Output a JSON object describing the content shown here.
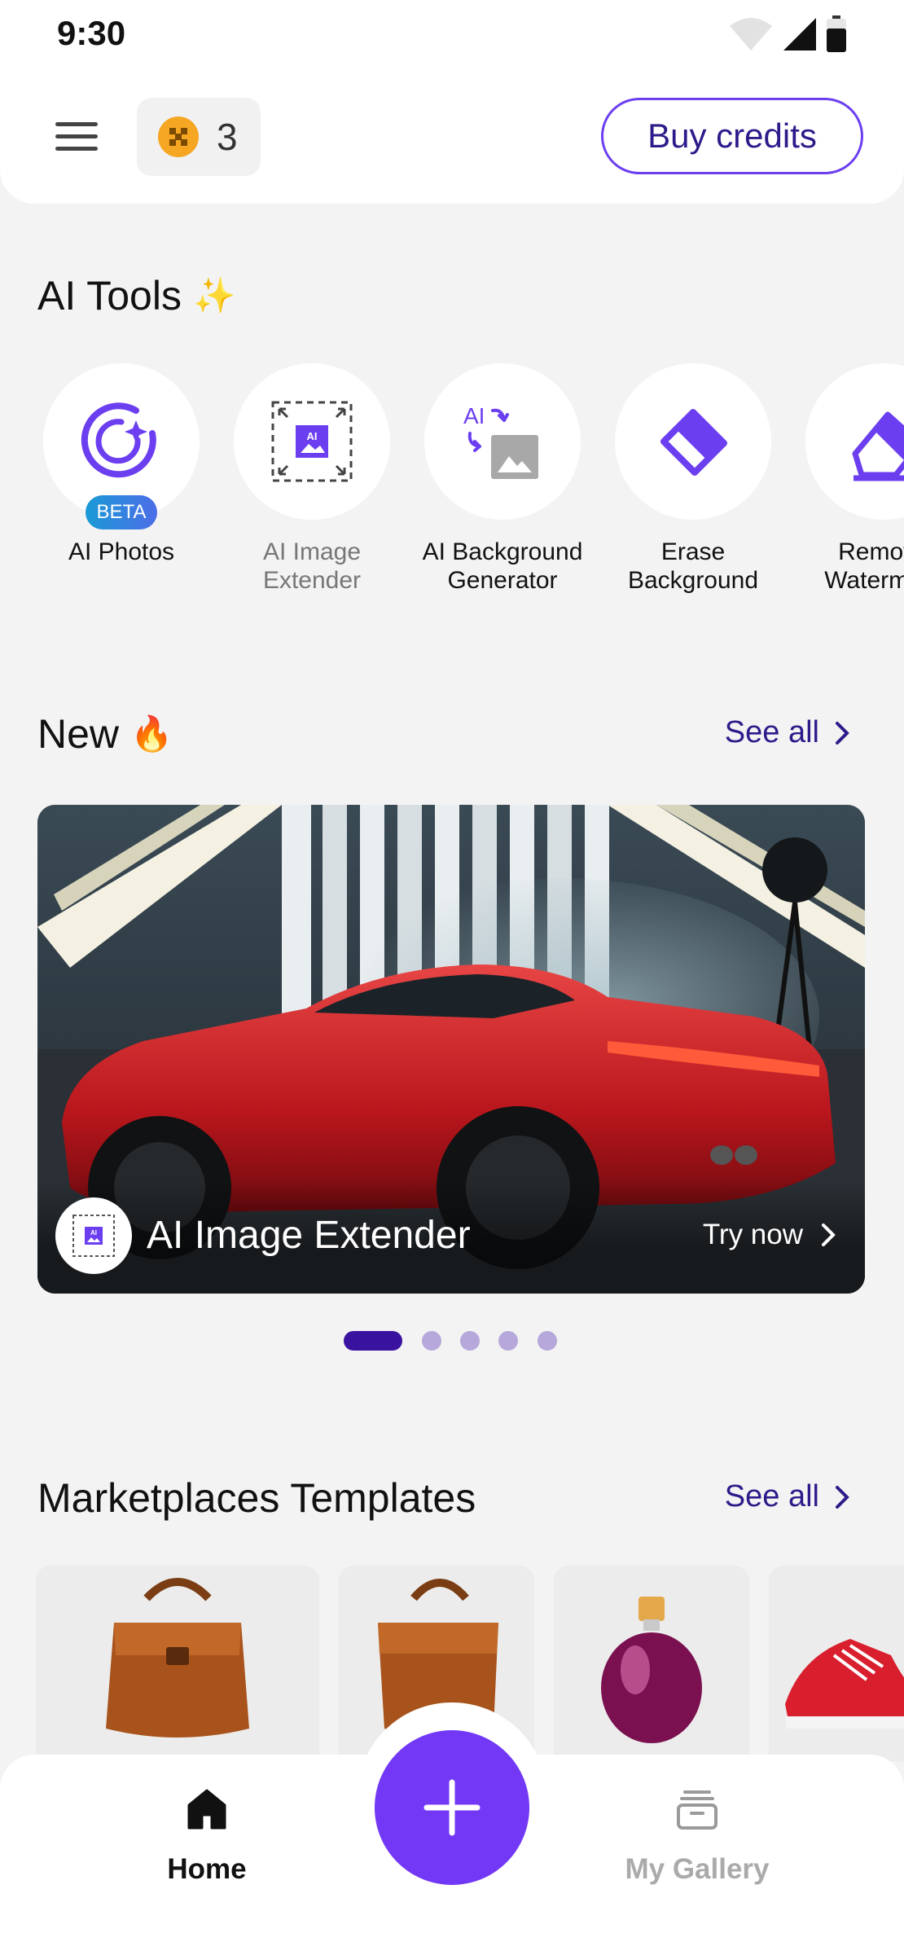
{
  "status_bar": {
    "time": "9:30"
  },
  "header": {
    "credits_count": "3",
    "buy_credits_label": "Buy credits"
  },
  "ai_tools": {
    "title": "AI Tools",
    "title_emoji": "✨",
    "items": [
      {
        "label": "AI Photos",
        "badge": "BETA",
        "icon": "ai-photos-icon"
      },
      {
        "label": "AI Image Extender",
        "icon": "image-extender-icon"
      },
      {
        "label": "AI Background Generator",
        "icon": "background-generator-icon"
      },
      {
        "label": "Erase Background",
        "icon": "eraser-icon"
      },
      {
        "label": "Remove Watermark",
        "icon": "watermark-eraser-icon"
      }
    ]
  },
  "new_section": {
    "title": "New",
    "title_emoji": "🔥",
    "see_all": "See all",
    "banner": {
      "title": "AI Image Extender",
      "cta": "Try now",
      "icon_text": "AI"
    },
    "carousel": {
      "count": 5,
      "active_index": 0
    }
  },
  "templates_section": {
    "title": "Marketplaces Templates",
    "see_all": "See all",
    "items": [
      {
        "product": "leather-bag"
      },
      {
        "product": "leather-bag"
      },
      {
        "product": "perfume-bottle"
      },
      {
        "product": "red-sneakers"
      }
    ]
  },
  "bottom_nav": {
    "home_label": "Home",
    "gallery_label": "My Gallery"
  },
  "colors": {
    "accent": "#7238F5",
    "accent_dark": "#2E1A8A",
    "coin": "#F5A623",
    "background": "#F3F3F3"
  }
}
